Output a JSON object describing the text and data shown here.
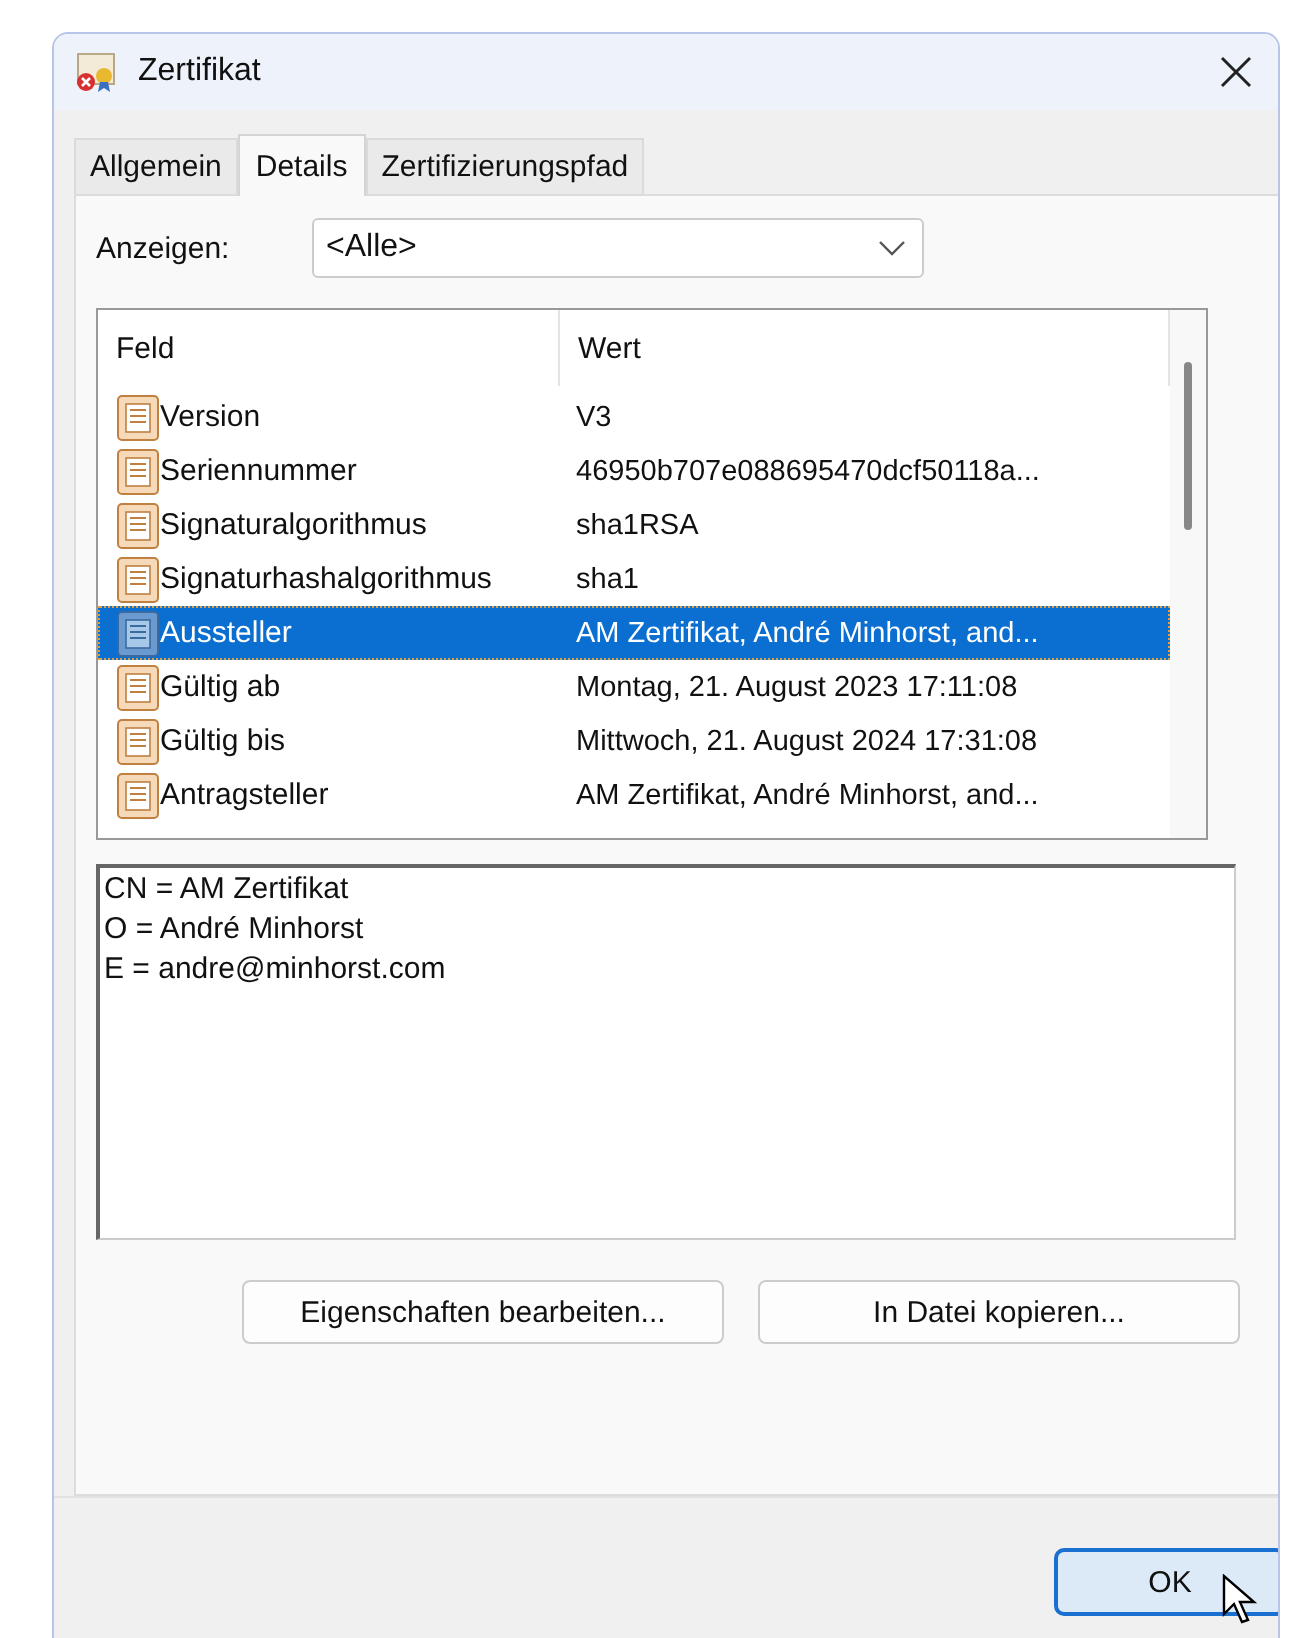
{
  "window": {
    "title": "Zertifikat"
  },
  "tabs": [
    {
      "label": "Allgemein",
      "selected": false
    },
    {
      "label": "Details",
      "selected": true
    },
    {
      "label": "Zertifizierungspfad",
      "selected": false
    }
  ],
  "show": {
    "label": "Anzeigen:",
    "value": "<Alle>"
  },
  "table": {
    "columns": [
      "Feld",
      "Wert"
    ],
    "rows": [
      {
        "field": "Version",
        "value": "V3",
        "selected": false
      },
      {
        "field": "Seriennummer",
        "value": "46950b707e088695470dcf50118a...",
        "selected": false
      },
      {
        "field": "Signaturalgorithmus",
        "value": "sha1RSA",
        "selected": false
      },
      {
        "field": "Signaturhashalgorithmus",
        "value": "sha1",
        "selected": false
      },
      {
        "field": "Aussteller",
        "value": "AM Zertifikat, André Minhorst, and...",
        "selected": true
      },
      {
        "field": "Gültig ab",
        "value": "Montag, 21. August 2023 17:11:08",
        "selected": false
      },
      {
        "field": "Gültig bis",
        "value": "Mittwoch, 21. August 2024 17:31:08",
        "selected": false
      },
      {
        "field": "Antragsteller",
        "value": "AM Zertifikat, André Minhorst, and...",
        "selected": false
      }
    ]
  },
  "detail_lines": [
    "CN = AM Zertifikat",
    "O = André Minhorst",
    "E = andre@minhorst.com"
  ],
  "buttons": [
    "Eigenschaften bearbeiten...",
    "In Datei kopieren..."
  ],
  "ok_button": "OK"
}
